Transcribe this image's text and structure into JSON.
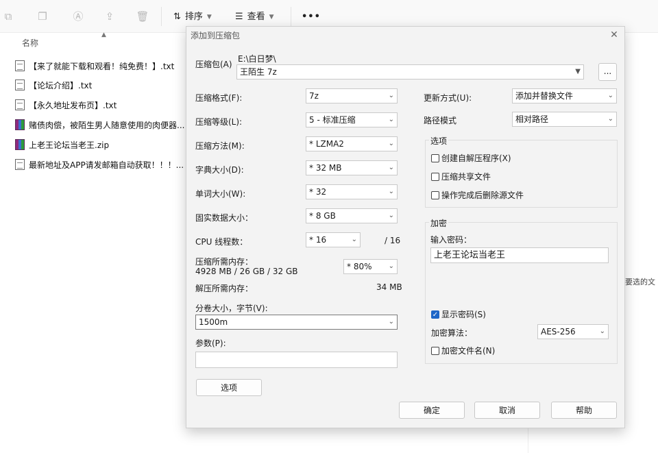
{
  "toolbar": {
    "sort_label": "排序",
    "view_label": "查看",
    "more_label": "•••"
  },
  "file_list": {
    "column_name": "名称",
    "items": [
      {
        "name": "【来了就能下载和观看！纯免费！】.txt",
        "icon": "txt-file-icon"
      },
      {
        "name": "【论坛介绍】.txt",
        "icon": "txt-file-icon"
      },
      {
        "name": "【永久地址发布页】.txt",
        "icon": "txt-file-icon"
      },
      {
        "name": "赌债肉偿，被陌生男人随意使用的肉便器...",
        "icon": "rar-archive-icon"
      },
      {
        "name": "上老王论坛当老王.zip",
        "icon": "rar-archive-icon"
      },
      {
        "name": "最新地址及APP请发邮箱自动获取！！！...",
        "icon": "txt-file-icon"
      }
    ],
    "side_text": "要选的文"
  },
  "dialog": {
    "title": "添加到压缩包",
    "archive_label": "压缩包(A)",
    "archive_path": "E:\\白日梦\\",
    "archive_name": "王陌生 7z",
    "browse_label": "...",
    "format_label": "压缩格式(F):",
    "format_value": "7z",
    "level_label": "压缩等级(L):",
    "level_value": "5 - 标准压缩",
    "method_label": "压缩方法(M):",
    "method_value": "* LZMA2",
    "dict_label": "字典大小(D):",
    "dict_value": "* 32 MB",
    "word_label": "单词大小(W):",
    "word_value": "* 32",
    "solid_label": "固实数据大小：",
    "solid_value": "* 8 GB",
    "threads_label": "CPU 线程数：",
    "threads_value": "* 16",
    "threads_total": "/ 16",
    "mem_comp_label": "压缩所需内存：",
    "mem_comp_value": "4928 MB / 26 GB / 32 GB",
    "mem_percent": "* 80%",
    "mem_decomp_label": "解压所需内存：",
    "mem_decomp_value": "34 MB",
    "split_label": "分卷大小，字节(V):",
    "split_value": "1500m",
    "params_label": "参数(P):",
    "params_value": "",
    "options_button": "选项",
    "update_label": "更新方式(U):",
    "update_value": "添加并替换文件",
    "path_label": "路径模式",
    "path_value": "相对路径",
    "options_group": "选项",
    "opt_sfx": "创建自解压程序(X)",
    "opt_shared": "压缩共享文件",
    "opt_delete": "操作完成后删除源文件",
    "enc_group": "加密",
    "pwd_label": "输入密码：",
    "pwd_value": "上老王论坛当老王",
    "show_pwd": "显示密码(S)",
    "enc_method_label": "加密算法：",
    "enc_method_value": "AES-256",
    "enc_names": "加密文件名(N)",
    "ok": "确定",
    "cancel": "取消",
    "help": "帮助"
  }
}
